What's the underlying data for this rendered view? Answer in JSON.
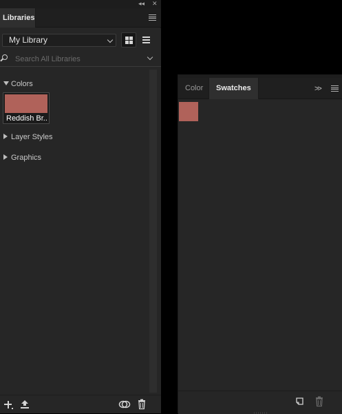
{
  "libraries_panel": {
    "tab_label": "Libraries",
    "collapse_controls": {
      "collapse": "◂◂",
      "close": "✕"
    },
    "library_select": {
      "value": "My Library"
    },
    "search": {
      "placeholder": "Search All Libraries",
      "value": ""
    },
    "sections": [
      {
        "label": "Colors",
        "expanded": true
      },
      {
        "label": "Layer Styles",
        "expanded": false
      },
      {
        "label": "Graphics",
        "expanded": false
      }
    ],
    "color_items": [
      {
        "name": "Reddish Br...",
        "color": "#b0625a"
      }
    ],
    "view_mode": "grid",
    "footer_icons": [
      "add-icon",
      "upload-icon",
      "creative-cloud-icon",
      "trash-icon"
    ]
  },
  "swatches_panel": {
    "tabs": [
      {
        "label": "Color",
        "active": false
      },
      {
        "label": "Swatches",
        "active": true
      }
    ],
    "more_label": ">>",
    "swatches": [
      {
        "color": "#b0625a"
      }
    ],
    "footer_icons": [
      "new-swatch-icon",
      "trash-icon"
    ]
  },
  "theme": {
    "panel_bg": "#262626",
    "tab_bar_bg": "#1f1f1f",
    "workspace_bg": "#000000"
  }
}
